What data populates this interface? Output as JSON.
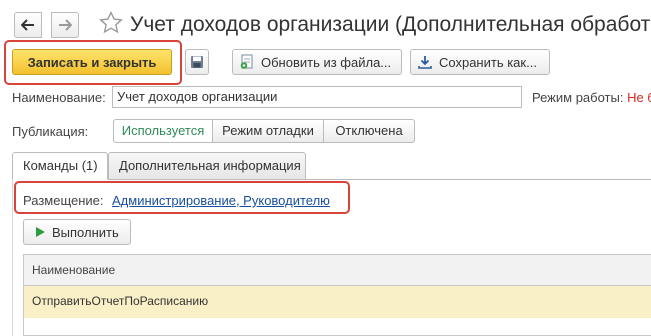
{
  "window": {
    "title": "Учет доходов организации (Дополнительная обработка)"
  },
  "toolbar": {
    "save_close_label": "Записать и закрыть",
    "update_from_file_label": "Обновить из файла...",
    "save_as_label": "Сохранить как..."
  },
  "form": {
    "name_label": "Наименование:",
    "name_value": "Учет доходов организации",
    "mode_label": "Режим работы:",
    "mode_value": "Не б",
    "publication_label": "Публикация:",
    "publication_options": [
      "Используется",
      "Режим отладки",
      "Отключена"
    ],
    "publication_selected": "Используется"
  },
  "tabs": [
    {
      "label": "Команды (1)",
      "active": true
    },
    {
      "label": "Дополнительная информация",
      "active": false
    }
  ],
  "commands": {
    "placement_label": "Размещение:",
    "placement_link": "Администрирование, Руководителю",
    "run_label": "Выполнить",
    "table": {
      "columns": [
        "Наименование"
      ],
      "rows": [
        {
          "name": "ОтправитьОтчетПоРасписанию",
          "selected": true
        }
      ]
    }
  },
  "colors": {
    "accent_yellow": "#f2c12e",
    "highlight_red": "#d9443a",
    "link_blue": "#1a4f9c",
    "selected_row": "#faf0c8",
    "active_green": "#2e8b57"
  }
}
